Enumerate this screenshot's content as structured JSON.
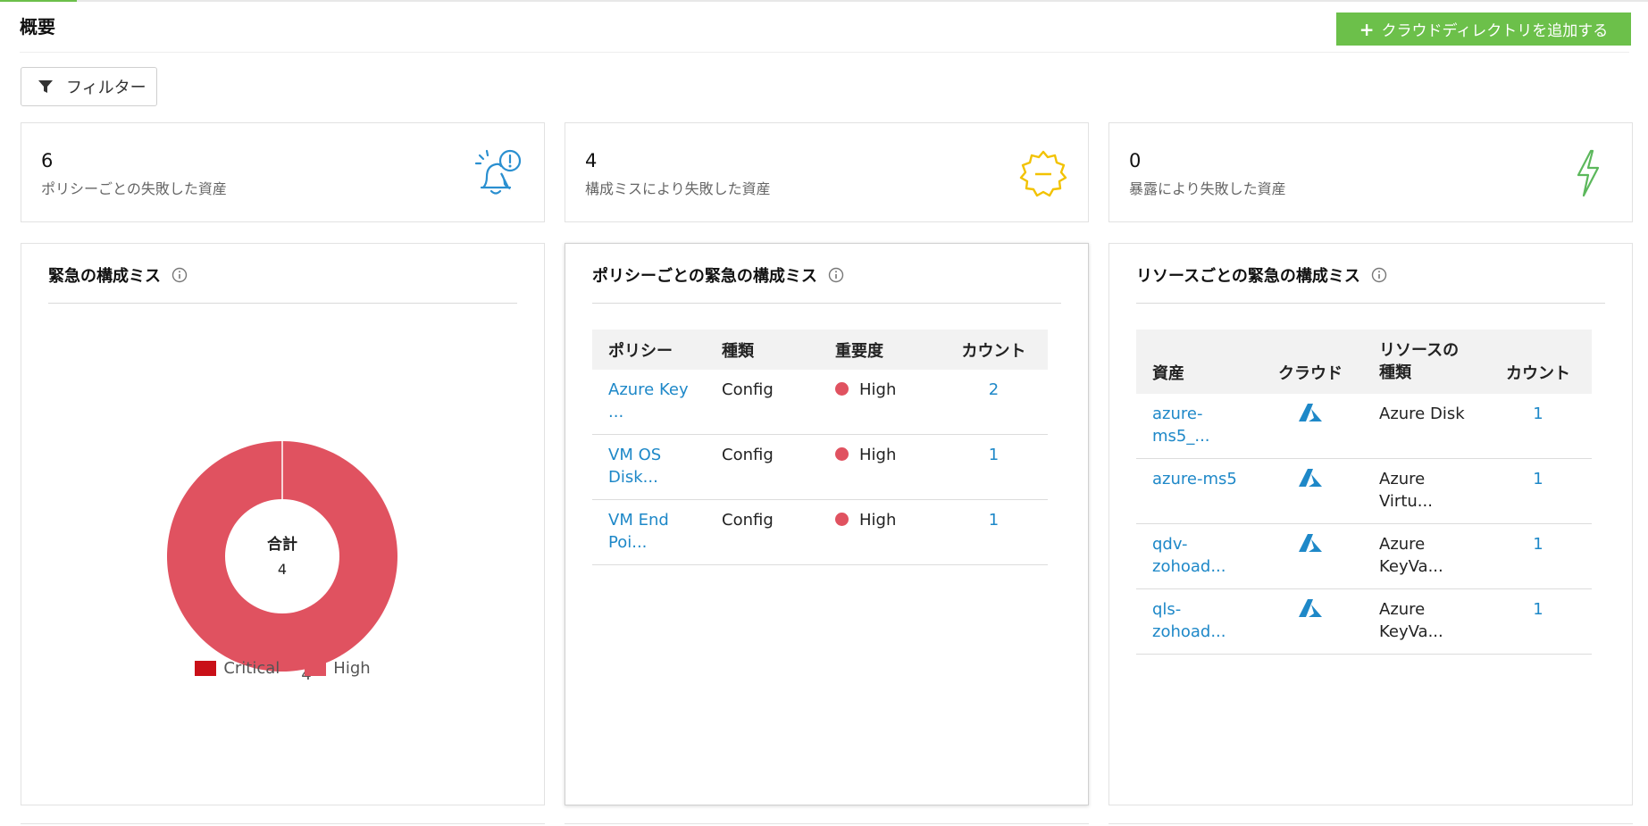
{
  "header": {
    "title": "概要",
    "add_button_label": "クラウドディレクトリを追加する",
    "filter_label": "フィルター"
  },
  "kpis": [
    {
      "value": "6",
      "label": "ポリシーごとの失敗した資産",
      "icon": "bell-alert-icon",
      "color": "#2a8fd0"
    },
    {
      "value": "4",
      "label": "構成ミスにより失敗した資産",
      "icon": "gear-minus-icon",
      "color": "#f2c200"
    },
    {
      "value": "0",
      "label": "暴露により失敗した資産",
      "icon": "lightning-icon",
      "color": "#5cb85c"
    }
  ],
  "donut_panel": {
    "title": "緊急の構成ミス",
    "center_label": "合計",
    "center_value": "4",
    "slice_label": "4",
    "legend": [
      {
        "label": "Critical",
        "color": "#c91018"
      },
      {
        "label": "High",
        "color": "#e05260"
      }
    ]
  },
  "chart_data": {
    "type": "pie",
    "categories": [
      "Critical",
      "High"
    ],
    "values": [
      0,
      4
    ],
    "colors": [
      "#c91018",
      "#e05260"
    ],
    "title": "緊急の構成ミス",
    "center_text": "合計",
    "center_value": 4,
    "legend_position": "bottom"
  },
  "policy_panel": {
    "title": "ポリシーごとの緊急の構成ミス",
    "columns": [
      "ポリシー",
      "種類",
      "重要度",
      "カウント"
    ],
    "rows": [
      {
        "policy": "Azure Key\n...",
        "type": "Config",
        "severity": "High",
        "count": "2"
      },
      {
        "policy": "VM OS\nDisk...",
        "type": "Config",
        "severity": "High",
        "count": "1"
      },
      {
        "policy": "VM End\nPoi...",
        "type": "Config",
        "severity": "High",
        "count": "1"
      }
    ]
  },
  "resource_panel": {
    "title": "リソースごとの緊急の構成ミス",
    "columns": [
      "資産",
      "クラウド",
      "リソースの\n種類",
      "カウント"
    ],
    "rows": [
      {
        "asset": "azure-\nms5_...",
        "cloud_icon": "azure-icon",
        "resource_type": "Azure Disk",
        "count": "1"
      },
      {
        "asset": "azure-ms5",
        "cloud_icon": "azure-icon",
        "resource_type": "Azure\nVirtu...",
        "count": "1"
      },
      {
        "asset": "qdv-\nzohoad...",
        "cloud_icon": "azure-icon",
        "resource_type": "Azure\nKeyVa...",
        "count": "1"
      },
      {
        "asset": "qls-\nzohoad...",
        "cloud_icon": "azure-icon",
        "resource_type": "Azure\nKeyVa...",
        "count": "1"
      }
    ]
  },
  "colors": {
    "accent_green": "#6cc04a",
    "link_blue": "#1e88c8",
    "severity_high": "#e05260"
  }
}
